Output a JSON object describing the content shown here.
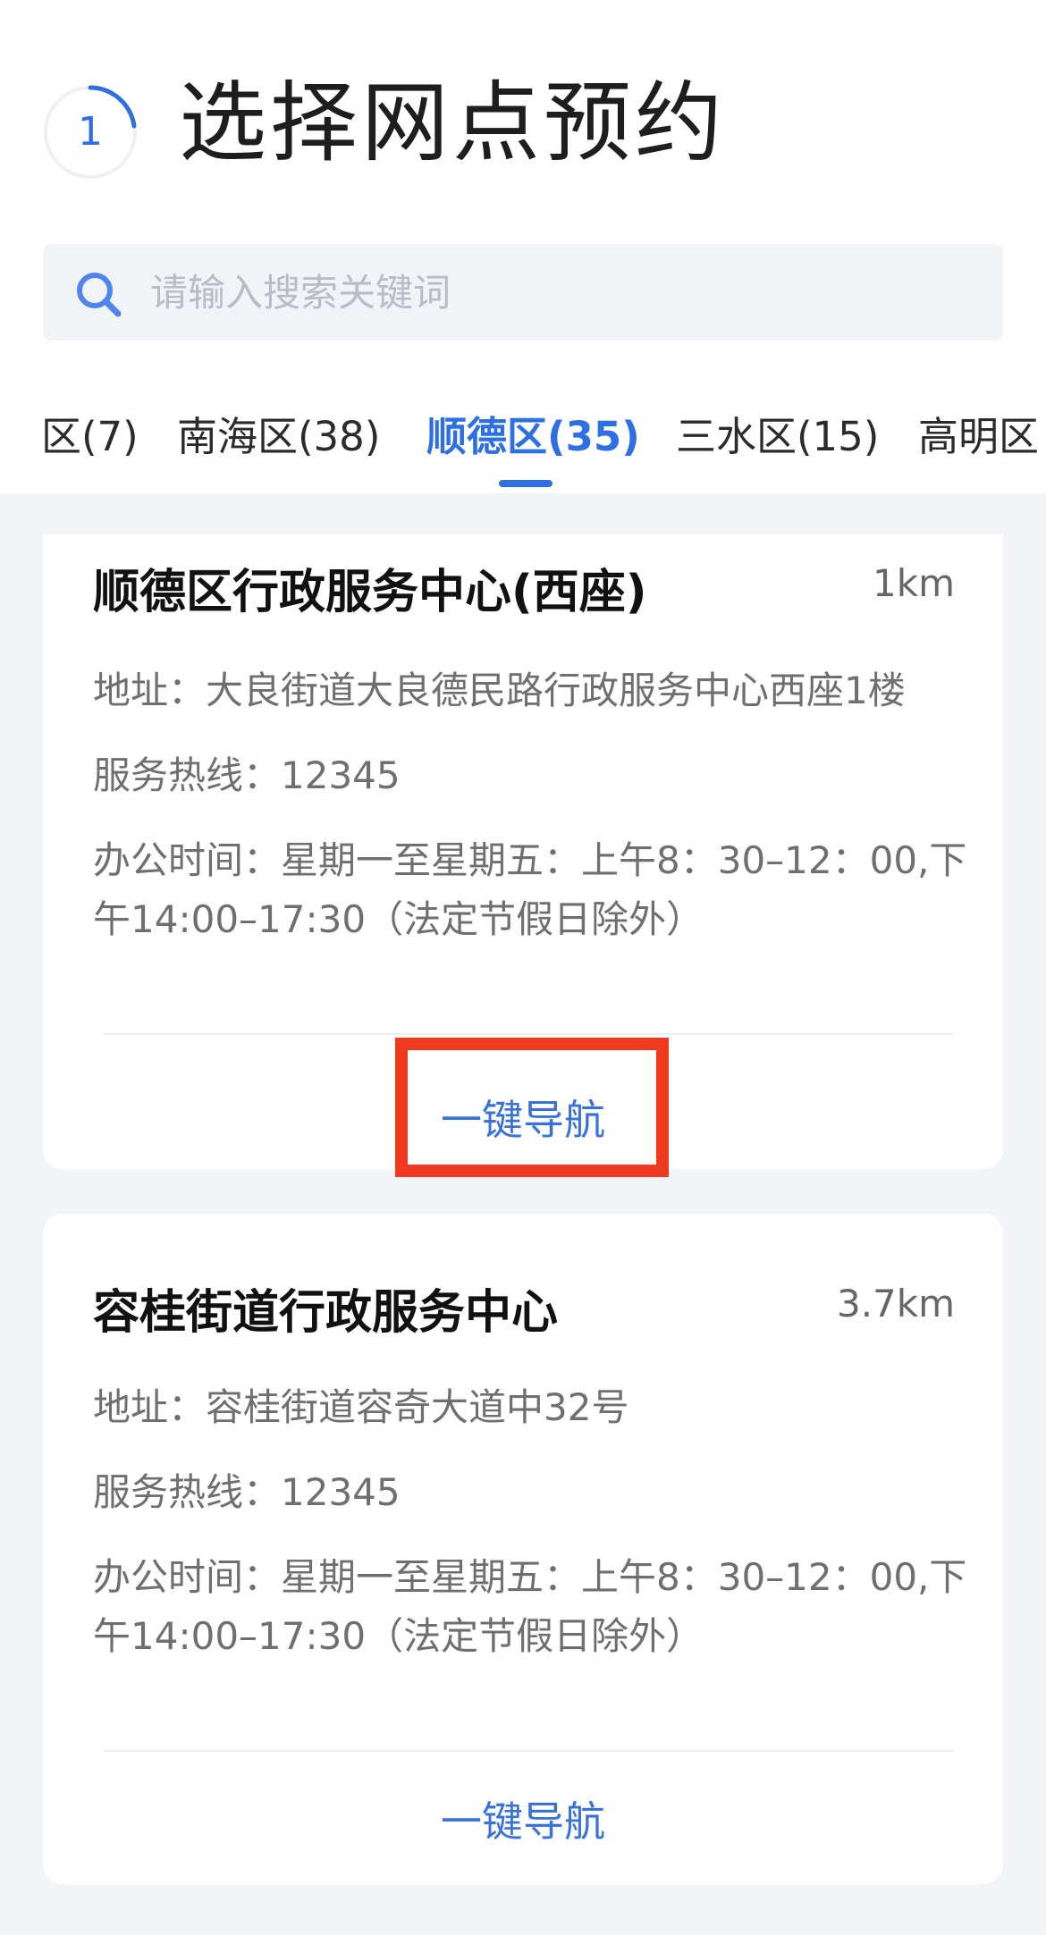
{
  "header": {
    "step_number": "1",
    "title": "选择网点预约"
  },
  "search": {
    "placeholder": "请输入搜索关键词"
  },
  "tabs": [
    {
      "label": "区(7)"
    },
    {
      "label": "南海区(38)"
    },
    {
      "label": "顺德区(35)",
      "active": true
    },
    {
      "label": "三水区(15)"
    },
    {
      "label": "高明区"
    }
  ],
  "cards": [
    {
      "name": "顺德区行政服务中心(西座)",
      "distance": "1km",
      "address": "地址：大良街道大良德民路行政服务中心西座1楼",
      "hotline": "服务热线：12345",
      "hours": "办公时间：星期一至星期五：上午8：30–12：00,下午14:00–17:30（法定节假日除外）",
      "nav_label": "一键导航"
    },
    {
      "name": "容桂街道行政服务中心",
      "distance": "3.7km",
      "address": "地址：容桂街道容奇大道中32号",
      "hotline": "服务热线：12345",
      "hours": "办公时间：星期一至星期五：上午8：30–12：00,下午14:00–17:30（法定节假日除外）",
      "nav_label": "一键导航"
    }
  ],
  "colors": {
    "accent": "#2f6fe4",
    "highlight": "#f03a1f",
    "background": "#f3f4f8"
  }
}
